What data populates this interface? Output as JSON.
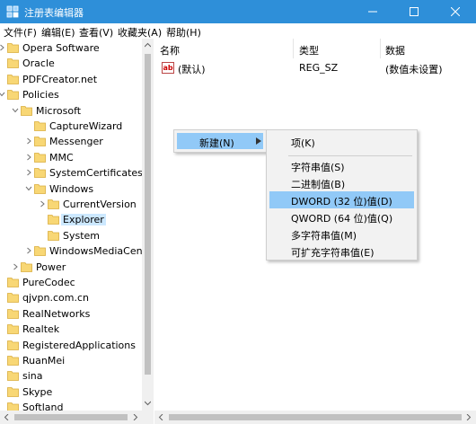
{
  "window": {
    "title": "注册表编辑器",
    "accent_color": "#2e8fd9",
    "controls": [
      "minimize-icon",
      "maximize-icon",
      "close-icon"
    ]
  },
  "menubar": {
    "items": [
      "文件(F)",
      "编辑(E)",
      "查看(V)",
      "收藏夹(A)",
      "帮助(H)"
    ]
  },
  "tree": {
    "items": [
      {
        "label": "Opera Software",
        "expander": "collapsed"
      },
      {
        "label": "Oracle",
        "expander": "none"
      },
      {
        "label": "PDFCreator.net",
        "expander": "none"
      },
      {
        "label": "Policies",
        "expander": "expanded"
      },
      {
        "label": "Microsoft",
        "expander": "expanded"
      },
      {
        "label": "CaptureWizard",
        "expander": "none"
      },
      {
        "label": "Messenger",
        "expander": "collapsed"
      },
      {
        "label": "MMC",
        "expander": "collapsed"
      },
      {
        "label": "SystemCertificates",
        "expander": "collapsed"
      },
      {
        "label": "Windows",
        "expander": "expanded"
      },
      {
        "label": "CurrentVersion",
        "expander": "collapsed"
      },
      {
        "label": "Explorer",
        "expander": "none",
        "selected": true
      },
      {
        "label": "System",
        "expander": "none"
      },
      {
        "label": "WindowsMediaCenter",
        "expander": "collapsed"
      },
      {
        "label": "Power",
        "expander": "collapsed"
      },
      {
        "label": "PureCodec",
        "expander": "none"
      },
      {
        "label": "qjvpn.com.cn",
        "expander": "none"
      },
      {
        "label": "RealNetworks",
        "expander": "none"
      },
      {
        "label": "Realtek",
        "expander": "none"
      },
      {
        "label": "RegisteredApplications",
        "expander": "none"
      },
      {
        "label": "RuanMei",
        "expander": "none"
      },
      {
        "label": "sina",
        "expander": "none"
      },
      {
        "label": "Skype",
        "expander": "none"
      },
      {
        "label": "Softland",
        "expander": "none"
      }
    ]
  },
  "values_list": {
    "columns": {
      "name": "名称",
      "type": "类型",
      "data": "数据"
    },
    "rows": [
      {
        "icon": "string-value-icon",
        "icon_text": "ab",
        "name": "(默认)",
        "type": "REG_SZ",
        "data": "(数值未设置)"
      }
    ]
  },
  "context_menu": {
    "new_label": "新建(N)",
    "submenu": {
      "key": "项(K)",
      "items": [
        {
          "label": "字符串值(S)",
          "highlighted": false
        },
        {
          "label": "二进制值(B)",
          "highlighted": false
        },
        {
          "label": "DWORD (32 位)值(D)",
          "highlighted": true
        },
        {
          "label": "QWORD (64 位)值(Q)",
          "highlighted": false
        },
        {
          "label": "多字符串值(M)",
          "highlighted": false
        },
        {
          "label": "可扩充字符串值(E)",
          "highlighted": false
        }
      ]
    },
    "highlight_color": "#91c9f7"
  },
  "folder_color": "#f8d775"
}
